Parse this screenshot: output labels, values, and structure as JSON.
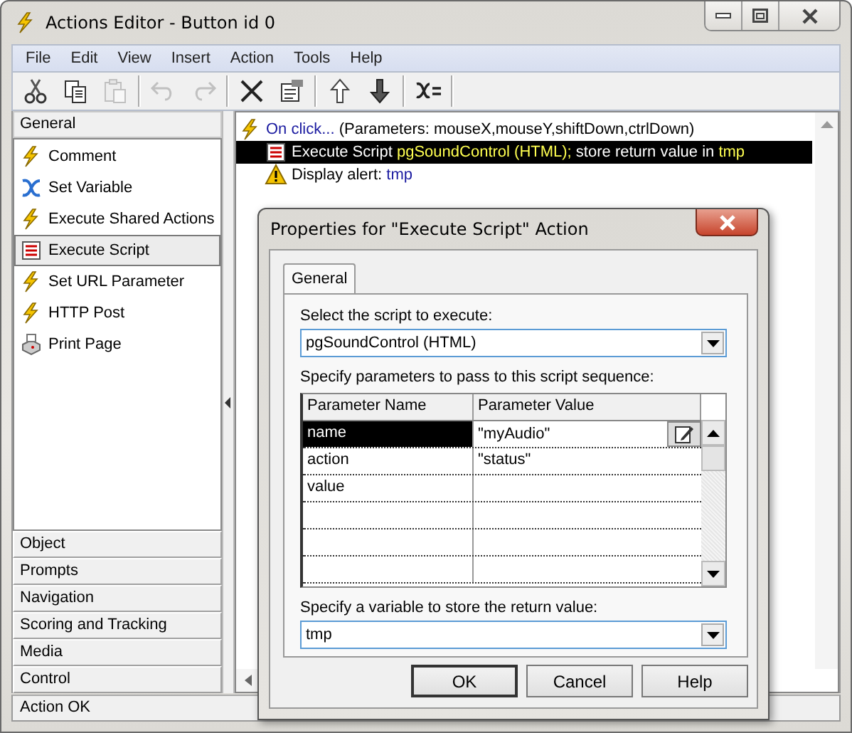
{
  "window": {
    "title": "Actions Editor - Button id 0"
  },
  "menu": [
    "File",
    "Edit",
    "View",
    "Insert",
    "Action",
    "Tools",
    "Help"
  ],
  "toolbar": [
    {
      "kind": "cut",
      "disabled": false
    },
    {
      "kind": "copy",
      "disabled": false
    },
    {
      "kind": "paste",
      "disabled": true
    },
    {
      "kind": "separator"
    },
    {
      "kind": "undo",
      "disabled": true
    },
    {
      "kind": "redo",
      "disabled": true
    },
    {
      "kind": "separator"
    },
    {
      "kind": "delete",
      "disabled": false
    },
    {
      "kind": "properties",
      "disabled": false
    },
    {
      "kind": "separator"
    },
    {
      "kind": "up",
      "disabled": false
    },
    {
      "kind": "down",
      "disabled": false
    },
    {
      "kind": "separator"
    },
    {
      "kind": "variable",
      "disabled": false
    },
    {
      "kind": "separator"
    }
  ],
  "sidebar": {
    "categories": [
      {
        "label": "General",
        "expanded": true,
        "items": [
          {
            "label": "Comment",
            "kind": "bolt",
            "selected": false
          },
          {
            "label": "Set Variable",
            "kind": "variable",
            "selected": false
          },
          {
            "label": "Execute Shared Actions",
            "kind": "bolt",
            "selected": false
          },
          {
            "label": "Execute Script",
            "kind": "script",
            "selected": true
          },
          {
            "label": "Set URL Parameter",
            "kind": "bolt",
            "selected": false
          },
          {
            "label": "HTTP Post",
            "kind": "bolt",
            "selected": false
          },
          {
            "label": "Print Page",
            "kind": "printer",
            "selected": false
          }
        ]
      },
      {
        "label": "Object",
        "expanded": false
      },
      {
        "label": "Prompts",
        "expanded": false
      },
      {
        "label": "Navigation",
        "expanded": false
      },
      {
        "label": "Scoring and Tracking",
        "expanded": false
      },
      {
        "label": "Media",
        "expanded": false
      },
      {
        "label": "Control",
        "expanded": false
      }
    ]
  },
  "actions": [
    {
      "kind": "bolt",
      "selected": false,
      "parts": [
        {
          "text": "On click...",
          "kind": "value"
        },
        {
          "text": "(Parameters: mouseX,mouseY,shiftDown,ctrlDown)",
          "kind": "plain"
        }
      ],
      "children": [
        {
          "kind": "script",
          "selected": true,
          "parts": [
            {
              "text": "Execute Script",
              "kind": "plain"
            },
            {
              "text": "pgSoundControl (HTML);",
              "kind": "value"
            },
            {
              "text": "store return value in",
              "kind": "plain"
            },
            {
              "text": "tmp",
              "kind": "value"
            }
          ]
        },
        {
          "kind": "warning",
          "selected": false,
          "parts": [
            {
              "text": "Display alert:",
              "kind": "plain"
            },
            {
              "text": "tmp",
              "kind": "value"
            }
          ]
        }
      ]
    }
  ],
  "status_bar": "Action OK",
  "dialog": {
    "title": "Properties for \"Execute Script\" Action",
    "tabs": [
      {
        "label": "General",
        "selected": true
      }
    ],
    "script_label": "Select the script to execute:",
    "script_value": "pgSoundControl (HTML)",
    "params_label": "Specify parameters to pass to this script sequence:",
    "columns": [
      "Parameter Name",
      "Parameter Value"
    ],
    "rows": [
      {
        "name": "name",
        "value": "\"myAudio\"",
        "selected": true
      },
      {
        "name": "action",
        "value": "\"status\"",
        "selected": false
      },
      {
        "name": "value",
        "selected": false
      }
    ],
    "variable_label": "Specify a variable to store the return value:",
    "variable_value": "tmp",
    "buttons": [
      "OK",
      "Cancel",
      "Help"
    ]
  }
}
